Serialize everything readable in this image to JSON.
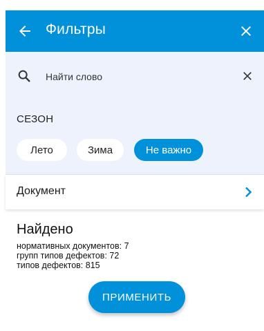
{
  "appbar": {
    "title": "Фильтры",
    "back_icon": "arrow-left-icon",
    "close_icon": "close-icon",
    "color": "#0091da"
  },
  "search": {
    "placeholder": "Найти слово",
    "value": "",
    "search_icon": "search-icon",
    "clear_icon": "close-icon"
  },
  "season": {
    "label": "СЕЗОН",
    "options": [
      {
        "label": "Лето",
        "selected": false
      },
      {
        "label": "Зима",
        "selected": false
      },
      {
        "label": "Не важно",
        "selected": true
      }
    ]
  },
  "document": {
    "label": "Документ",
    "chevron_icon": "chevron-right-icon"
  },
  "results": {
    "heading": "Найдено",
    "stats": [
      "нормативных документов: 7",
      "групп типов дефектов: 72",
      "типов дефектов: 815"
    ]
  },
  "apply_button": {
    "label": "ПРИМЕНИТЬ"
  }
}
